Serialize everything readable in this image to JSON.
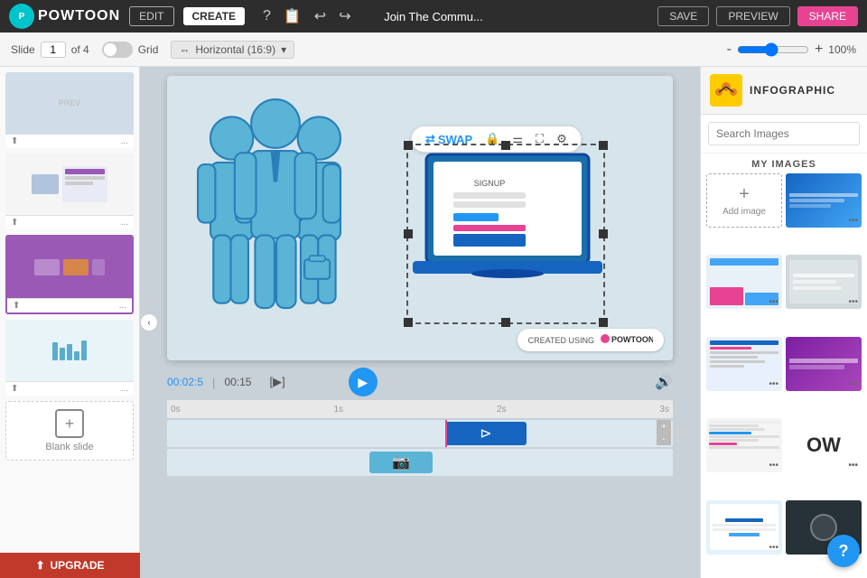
{
  "topBar": {
    "logo": "POWTOON",
    "editLabel": "EDIT",
    "createLabel": "CREATE",
    "title": "Join The Commu...",
    "helpTooltip": "?",
    "saveLabel": "SAVE",
    "previewLabel": "PREVIEW",
    "shareLabel": "SHARE"
  },
  "toolbar": {
    "slideLabel": "Slide",
    "slideNum": "1",
    "slideOf": "of 4",
    "gridLabel": "Grid",
    "orientationLabel": "Horizontal (16:9)",
    "zoomMinus": "-",
    "zoomPlus": "+",
    "zoomValue": "100%"
  },
  "floatToolbar": {
    "swapLabel": "SWAP",
    "lockIcon": "🔒",
    "adjustIcon": "⚙",
    "cropIcon": "✂",
    "settingsIcon": "⚙"
  },
  "canvas": {
    "watermarkText": "CREATED USING",
    "watermarkBrand": "POWTOON"
  },
  "timeline": {
    "currentTime": "00:02:5",
    "separator": "|",
    "totalTime": "00:15",
    "markers": [
      "0s",
      "1s",
      "2s",
      "3s"
    ]
  },
  "rightPanel": {
    "headerLabel": "INFOGRAPHIC",
    "searchPlaceholder": "Search Images",
    "myImagesLabel": "MY IMAGES",
    "addImageLabel": "Add image",
    "addImagePlus": "+"
  },
  "slides": [
    {
      "id": 1,
      "label": "PREV",
      "active": false
    },
    {
      "id": 2,
      "label": "",
      "active": false
    },
    {
      "id": 3,
      "label": "",
      "active": true
    },
    {
      "id": 4,
      "label": "",
      "active": false
    }
  ],
  "upgradeBar": {
    "label": "UPGRADE"
  },
  "blankSlide": {
    "label": "Blank slide"
  },
  "helpButton": {
    "label": "?"
  },
  "moreButton": {
    "label": "..."
  }
}
